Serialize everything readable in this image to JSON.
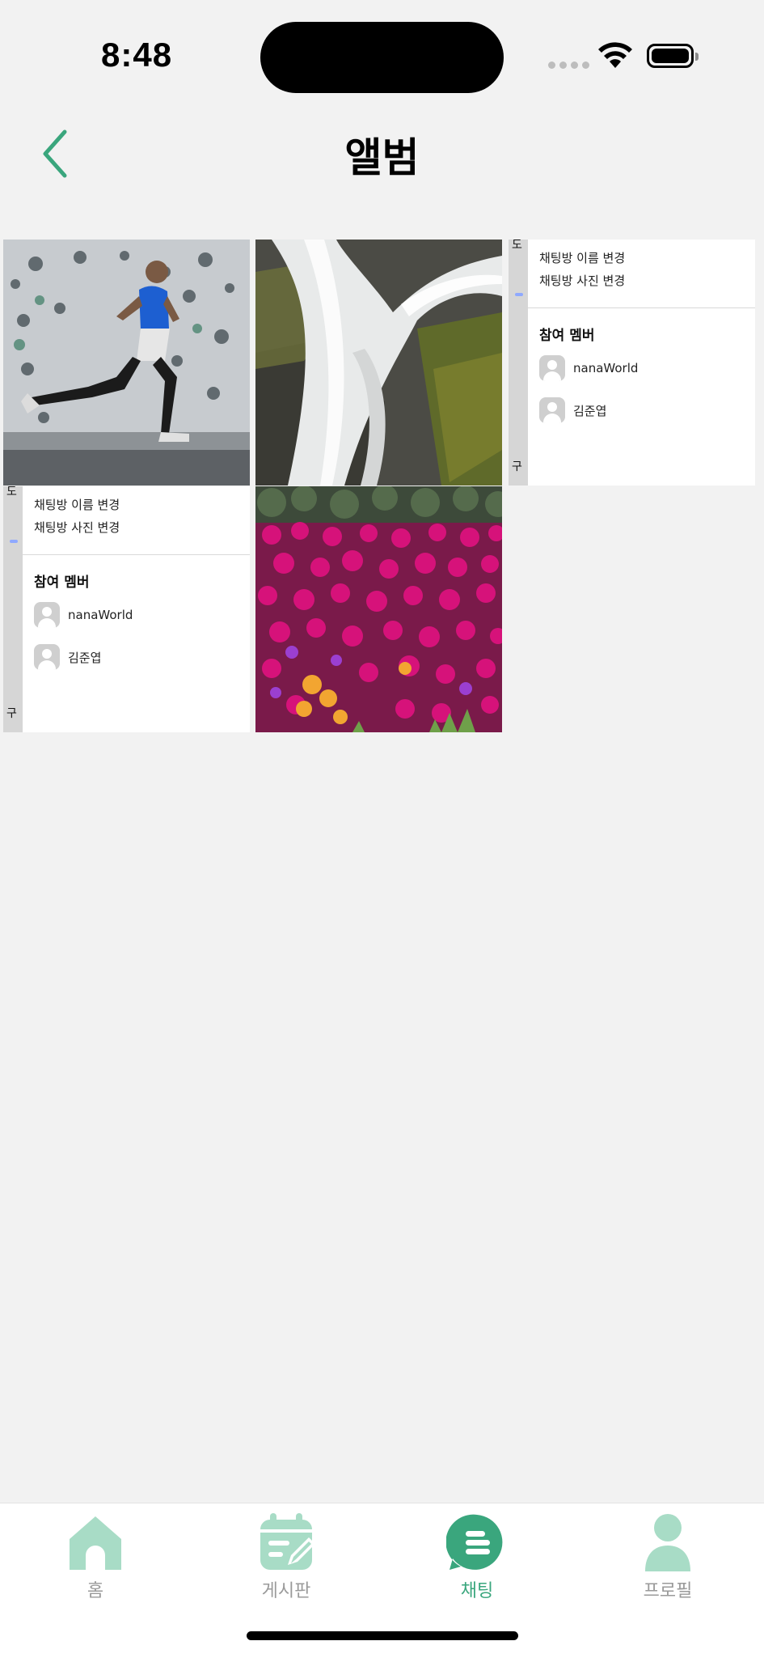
{
  "status_bar": {
    "time": "8:48"
  },
  "header": {
    "title": "앨범",
    "back_icon": "chevron-left-icon"
  },
  "colors": {
    "accent": "#3aa67d",
    "tab_inactive": "#a8dcc6",
    "background": "#f2f2f2"
  },
  "album": {
    "photos": [
      {
        "kind": "photo",
        "subject": "runner"
      },
      {
        "kind": "photo",
        "subject": "waterfall"
      },
      {
        "kind": "screenshot",
        "menu_rename": "채팅방 이름 변경",
        "menu_photo": "채팅방 사진 변경",
        "members_title": "참여 멤버",
        "members": [
          "nanaWorld",
          "김준엽"
        ],
        "edge_top": "도",
        "edge_bottom": "구"
      },
      {
        "kind": "screenshot",
        "menu_rename": "채팅방 이름 변경",
        "menu_photo": "채팅방 사진 변경",
        "members_title": "참여 멤버",
        "members": [
          "nanaWorld",
          "김준엽"
        ],
        "edge_top": "도",
        "edge_bottom": "구"
      },
      {
        "kind": "photo",
        "subject": "flowers"
      }
    ]
  },
  "tab_bar": {
    "items": [
      {
        "label": "홈",
        "icon": "home-icon"
      },
      {
        "label": "게시판",
        "icon": "board-icon"
      },
      {
        "label": "채팅",
        "icon": "chat-icon",
        "active": true
      },
      {
        "label": "프로필",
        "icon": "profile-icon"
      }
    ]
  }
}
